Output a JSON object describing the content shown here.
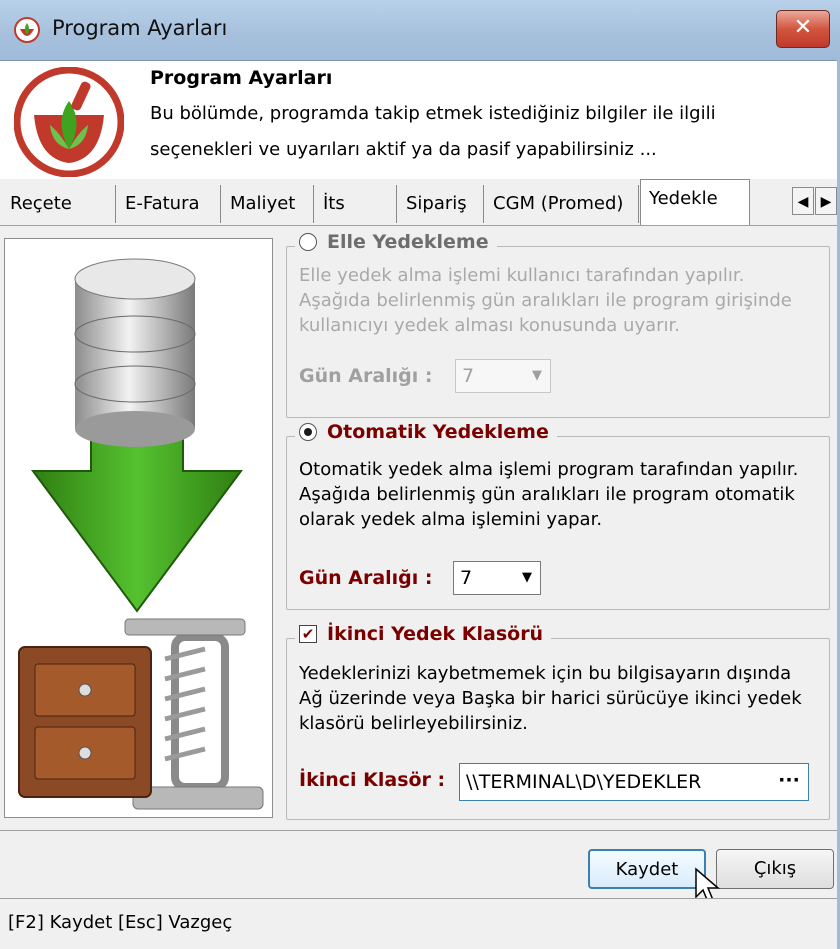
{
  "window": {
    "title": "Program Ayarları",
    "close_label": "✕"
  },
  "header": {
    "title": "Program Ayarları",
    "line1": "Bu bölümde, programda takip etmek istediğiniz bilgiler ile ilgili",
    "line2": "seçenekleri ve uyarıları aktif ya da pasif yapabilirsiniz ..."
  },
  "tabs": [
    "Reçete",
    "E-Fatura",
    "Maliyet",
    "İts",
    "Sipariş",
    "CGM (Promed)",
    "Yedekle"
  ],
  "active_tab": "Yedekle",
  "tab_scroll": {
    "left": "◀",
    "right": "▶"
  },
  "manual": {
    "title": "Elle Yedekleme",
    "selected": false,
    "desc1": "Elle yedek alma işlemi kullanıcı tarafından yapılır.",
    "desc2": "Aşağıda belirlenmiş gün aralıkları ile program girişinde",
    "desc3": "kullanıcıyı yedek alması konusunda uyarır.",
    "interval_label": "Gün Aralığı :",
    "interval_value": "7"
  },
  "auto": {
    "title": "Otomatik Yedekleme",
    "selected": true,
    "desc1": "Otomatik yedek alma işlemi program tarafından yapılır.",
    "desc2": "Aşağıda belirlenmiş gün aralıkları ile program otomatik",
    "desc3": "olarak yedek alma işlemini yapar.",
    "interval_label": "Gün Aralığı :",
    "interval_value": "7"
  },
  "second": {
    "title": "İkinci Yedek Klasörü",
    "checked": true,
    "check_mark": "✔",
    "desc1": "Yedeklerinizi kaybetmemek için bu bilgisayarın dışında",
    "desc2": "Ağ üzerinde veya Başka bir harici sürücüye ikinci yedek",
    "desc3": "klasörü belirleyebilirsiniz.",
    "folder_label": "İkinci Klasör :",
    "folder_value": "\\\\TERMINAL\\D\\YEDEKLER",
    "browse_label": "···"
  },
  "buttons": {
    "save": "Kaydet",
    "exit": "Çıkış"
  },
  "status": {
    "text": "[F2] Kaydet   [Esc] Vazgeç"
  },
  "colors": {
    "accent_label": "#7a0000",
    "focus_border": "#3c7fb1",
    "arrow_green": "#3fa31f"
  }
}
